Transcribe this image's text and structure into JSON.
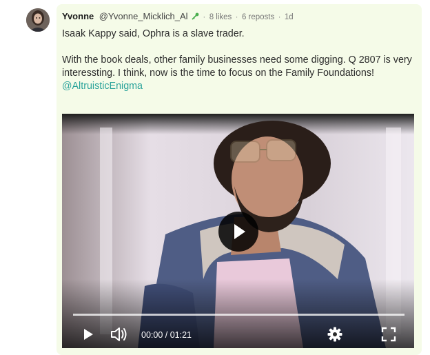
{
  "post": {
    "author_name": "Yvonne",
    "author_handle": "@Yvonne_Micklich_Al",
    "likes": "8 likes",
    "reposts": "6 reposts",
    "age": "1d",
    "separator": "·",
    "line1": "Isaak Kappy said, Ophra is a slave trader.",
    "line2": "With the book deals, other family businesses need some digging. Q 2807 is very interessting. I think, now is the time to focus on the Family Foundations!",
    "mention": "@AltruisticEnigma"
  },
  "video": {
    "time_display": "00:00 / 01:21",
    "progress": 0
  },
  "colors": {
    "post_background": "#f5fbe8",
    "mention": "#2aa39a",
    "verified": "#4caf50"
  }
}
